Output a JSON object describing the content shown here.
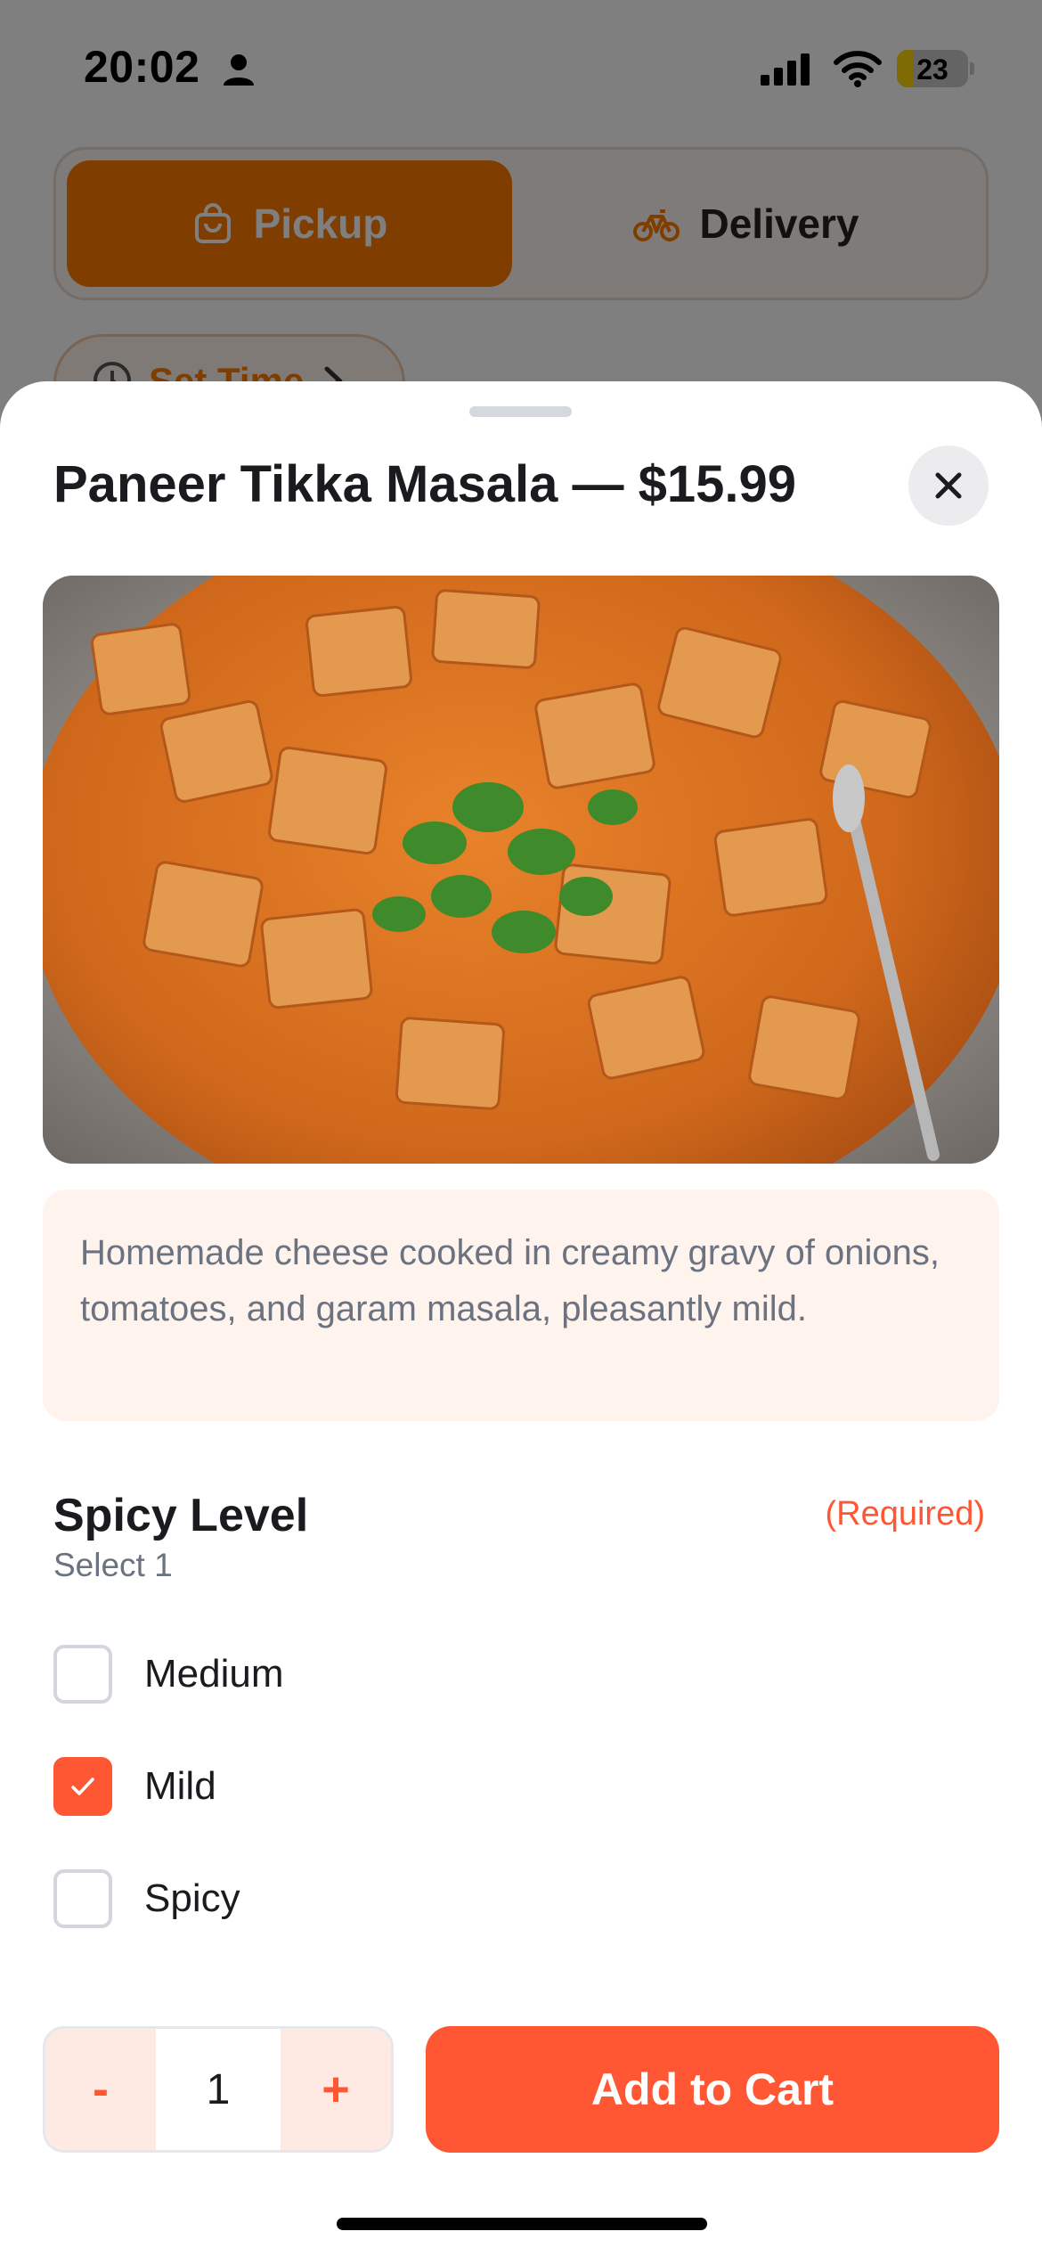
{
  "status_bar": {
    "time": "20:02",
    "battery_level": "23",
    "icons": [
      "person-icon",
      "cellular-signal-icon",
      "wifi-icon",
      "battery-icon"
    ]
  },
  "background": {
    "order_mode": {
      "pickup_label": "Pickup",
      "delivery_label": "Delivery",
      "selected": "Pickup"
    },
    "set_time_label": "Set Time"
  },
  "sheet": {
    "title": "Paneer Tikka Masala — $15.99",
    "image_alt": "Paneer tikka masala in a pan with cilantro",
    "description": "Homemade cheese cooked in creamy gravy of onions, tomatoes, and garam masala, pleasantly mild.",
    "option_group": {
      "title": "Spicy Level",
      "required_label": "(Required)",
      "subtitle": "Select 1",
      "options": [
        {
          "label": "Medium",
          "checked": false
        },
        {
          "label": "Mild",
          "checked": true
        },
        {
          "label": "Spicy",
          "checked": false
        }
      ]
    },
    "quantity": {
      "minus_label": "-",
      "value": "1",
      "plus_label": "+"
    },
    "add_to_cart_label": "Add to Cart"
  },
  "colors": {
    "accent": "#ff5733",
    "pickup_orange": "#ff7a00",
    "description_bg": "#fff3ee",
    "stepper_bg": "#ffe9e3"
  }
}
